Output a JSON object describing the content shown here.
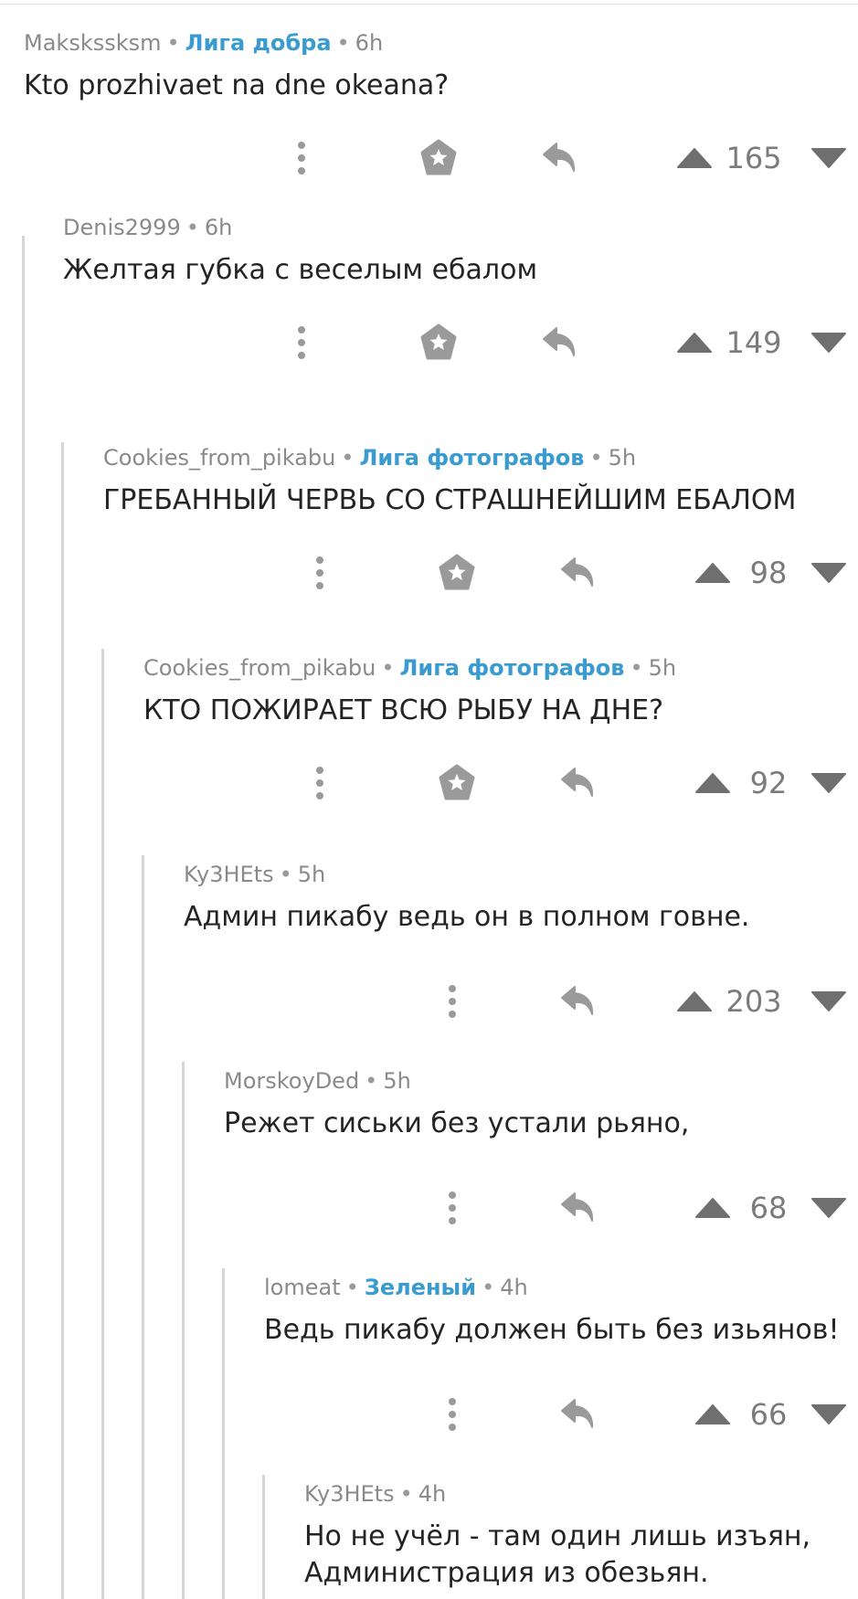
{
  "comments": [
    {
      "author": "Makskssksm",
      "league": "Лига добра",
      "time": "6h",
      "text": "Kto prozhivaet na dne okeana?",
      "score": "165",
      "has_save": true
    },
    {
      "author": "Denis2999",
      "league": "",
      "time": "6h",
      "text": "Желтая губка с веселым ебалом",
      "score": "149",
      "has_save": true
    },
    {
      "author": "Cookies_from_pikabu",
      "league": "Лига фотографов",
      "time": "5h",
      "text": "ГРЕБАННЫЙ ЧЕРВЬ СО СТРАШНЕЙШИМ ЕБАЛОМ",
      "score": "98",
      "has_save": true
    },
    {
      "author": "Cookies_from_pikabu",
      "league": "Лига фотографов",
      "time": "5h",
      "text": "КТО ПОЖИРАЕТ ВСЮ РЫБУ НА ДНЕ?",
      "score": "92",
      "has_save": true
    },
    {
      "author": "Ky3HEts",
      "league": "",
      "time": "5h",
      "text": "Админ пикабу ведь он в полном говне.",
      "score": "203",
      "has_save": false
    },
    {
      "author": "MorskoyDed",
      "league": "",
      "time": "5h",
      "text": "Режет сиськи без устали рьяно,",
      "score": "68",
      "has_save": false
    },
    {
      "author": "lomeat",
      "league": "Зеленый",
      "time": "4h",
      "text": "Ведь пикабу должен быть без изьянов!",
      "score": "66",
      "has_save": false
    },
    {
      "author": "Ky3HEts",
      "league": "",
      "time": "4h",
      "text": "Но не учёл - там один лишь изъян,\nАдминистрация из обезьян.",
      "score": "",
      "has_save": false
    }
  ],
  "icons": {
    "more": "more-vertical-icon",
    "save": "save-star-icon",
    "reply": "reply-icon",
    "upvote": "upvote-icon",
    "downvote": "downvote-icon"
  },
  "colors": {
    "league": "#3a9bd0",
    "icon": "#9a9a9a",
    "vote": "#6f6f6f",
    "score": "#7b7b7b",
    "rail": "#d6d6d6"
  }
}
